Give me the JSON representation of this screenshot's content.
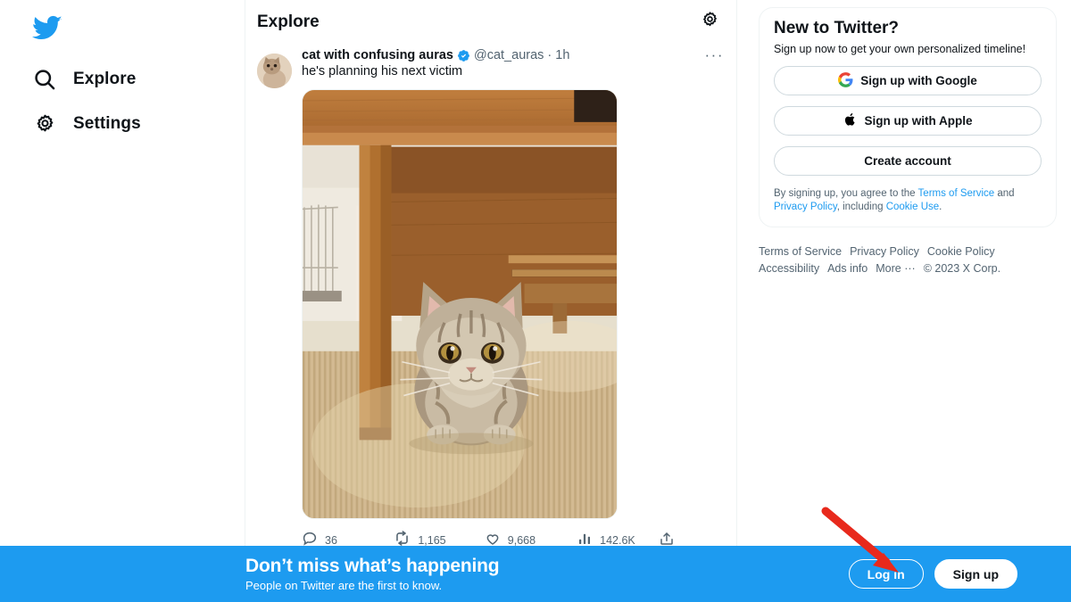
{
  "sidebar": {
    "logo": "twitter-bird-logo",
    "items": [
      {
        "label": "Explore",
        "icon": "search-icon"
      },
      {
        "label": "Settings",
        "icon": "gear-icon"
      }
    ]
  },
  "center": {
    "header": {
      "title": "Explore",
      "settings_icon": "gear-icon"
    },
    "tweet": {
      "display_name": "cat with confusing auras",
      "verified_badge": "verified-icon",
      "handle": "@cat_auras",
      "separator": "·",
      "timestamp": "1h",
      "more_label": "···",
      "text": "he's planning his next victim",
      "image_alt": "tabby cat sitting under a wooden table on a tatami mat",
      "actions": [
        {
          "name": "reply",
          "icon": "reply-icon",
          "count": "36"
        },
        {
          "name": "retweet",
          "icon": "retweet-icon",
          "count": "1,165"
        },
        {
          "name": "like",
          "icon": "heart-icon",
          "count": "9,668"
        },
        {
          "name": "views",
          "icon": "analytics-icon",
          "count": "142.6K"
        },
        {
          "name": "share",
          "icon": "share-icon",
          "count": ""
        }
      ]
    }
  },
  "right": {
    "signup": {
      "title": "New to Twitter?",
      "subtitle": "Sign up now to get your own personalized timeline!",
      "google_button": "Sign up with Google",
      "apple_button": "Sign up with Apple",
      "create_button": "Create account",
      "legal_prefix": "By signing up, you agree to the ",
      "legal_terms": "Terms of Service",
      "legal_and": " and ",
      "legal_privacy": "Privacy Policy",
      "legal_including": ", including ",
      "legal_cookie": "Cookie Use",
      "legal_suffix": "."
    },
    "footer_links": [
      "Terms of Service",
      "Privacy Policy",
      "Cookie Policy",
      "Accessibility",
      "Ads info",
      "More ···"
    ],
    "copyright": "© 2023 X Corp."
  },
  "banner": {
    "headline": "Don’t miss what’s happening",
    "subtext": "People on Twitter are the first to know.",
    "login_label": "Log in",
    "signup_label": "Sign up"
  },
  "annotation": {
    "arrow": "red-arrow-pointing-to-login-button"
  },
  "colors": {
    "twitter_blue": "#1D9BF0",
    "text_primary": "#0F1419",
    "text_secondary": "#536471",
    "border": "#EFF3F4",
    "arrow_red": "#E8291C"
  }
}
